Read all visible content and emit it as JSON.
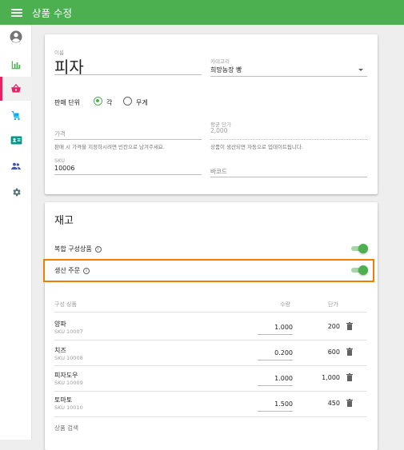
{
  "app": {
    "title": "상품 수정"
  },
  "sidebar": {
    "items": [
      "account",
      "reports",
      "sales",
      "delivery",
      "id-card",
      "people",
      "settings"
    ]
  },
  "product": {
    "name_label": "이름",
    "name_value": "피자",
    "category_label": "카테고리",
    "category_value": "희망농장 빵",
    "unit_label": "판매 단위",
    "unit_each": "각",
    "unit_weight": "무게",
    "unit_selected": "각",
    "price_placeholder": "가격",
    "price_hint": "판매 시 가격을 지정하시려면 빈칸으로 남겨주세요.",
    "avg_cost_label": "평균 단가",
    "avg_cost_value": "2,000",
    "avg_cost_hint": "상품이 생산되면 자동으로 업데이트됩니다.",
    "sku_label": "SKU",
    "sku_value": "10006",
    "barcode_placeholder": "바코드"
  },
  "inventory": {
    "title": "재고",
    "composite_label": "복합 구성상품",
    "composite_on": true,
    "production_label": "생산 주문",
    "production_on": true,
    "col_item": "구성 상품",
    "col_qty": "수량",
    "col_cost": "단가",
    "rows": [
      {
        "name": "양파",
        "sku": "SKU 10007",
        "qty": "1.000",
        "cost": "200"
      },
      {
        "name": "치즈",
        "sku": "SKU 10008",
        "qty": "0.200",
        "cost": "600"
      },
      {
        "name": "피자도우",
        "sku": "SKU 10009",
        "qty": "1.000",
        "cost": "1,000"
      },
      {
        "name": "토마토",
        "sku": "SKU 10010",
        "qty": "1.500",
        "cost": "450"
      }
    ],
    "search_placeholder": "상품 검색"
  },
  "colors": {
    "primary": "#4caf50",
    "highlight": "#f57c00",
    "active_nav": "#e91e63"
  }
}
